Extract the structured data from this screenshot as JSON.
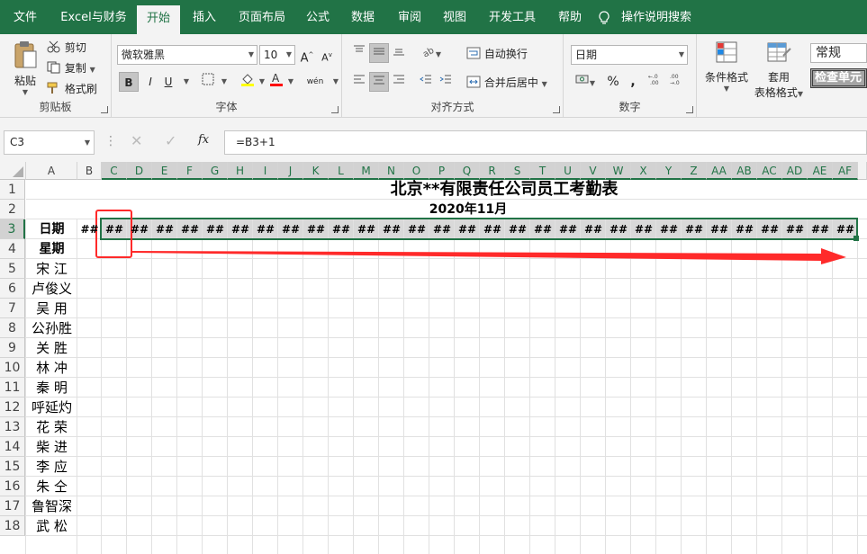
{
  "tabs": [
    {
      "label": "文件"
    },
    {
      "label": "Excel与财务"
    },
    {
      "label": "开始",
      "active": true
    },
    {
      "label": "插入"
    },
    {
      "label": "页面布局"
    },
    {
      "label": "公式"
    },
    {
      "label": "数据"
    },
    {
      "label": "审阅"
    },
    {
      "label": "视图"
    },
    {
      "label": "开发工具"
    },
    {
      "label": "帮助"
    },
    {
      "label": "操作说明搜索"
    }
  ],
  "clipboard": {
    "paste": "粘贴",
    "cut": "剪切",
    "copy": "复制",
    "format_painter": "格式刷",
    "group": "剪贴板"
  },
  "font": {
    "name": "微软雅黑",
    "size": "10",
    "bold": "B",
    "italic": "I",
    "underline": "U",
    "phonetic": "wén",
    "group": "字体"
  },
  "alignment": {
    "wrap": "自动换行",
    "merge": "合并后居中",
    "group": "对齐方式"
  },
  "number": {
    "format": "日期",
    "percent": "%",
    "comma": ",",
    "group": "数字"
  },
  "styles": {
    "conditional": "条件格式",
    "table_line1": "套用",
    "table_line2": "表格格式",
    "normal": "常规",
    "check_cell": "检查单元"
  },
  "formula_bar": {
    "name_box": "C3",
    "formula": "=B3+1",
    "fx": "fx"
  },
  "columns": [
    "A",
    "B",
    "C",
    "D",
    "E",
    "F",
    "G",
    "H",
    "I",
    "J",
    "K",
    "L",
    "M",
    "N",
    "O",
    "P",
    "Q",
    "R",
    "S",
    "T",
    "U",
    "V",
    "W",
    "X",
    "Y",
    "Z",
    "AA",
    "AB",
    "AC",
    "AD",
    "AE",
    "AF"
  ],
  "rows": [
    "1",
    "2",
    "3",
    "4",
    "5",
    "6",
    "7",
    "8",
    "9",
    "10",
    "11",
    "12",
    "13",
    "14",
    "15",
    "16",
    "17",
    "18"
  ],
  "sheet": {
    "title": "北京**有限责任公司员工考勤表",
    "month": "2020年11月",
    "date_label": "日期",
    "weekday_label": "星期",
    "overflow": "##",
    "employees": [
      "宋 江",
      "卢俊义",
      "吴 用",
      "公孙胜",
      "关 胜",
      "林 冲",
      "秦 明",
      "呼延灼",
      "花 荣",
      "柴 进",
      "李 应",
      "朱 仝",
      "鲁智深",
      "武 松"
    ]
  },
  "colors": {
    "accent": "#217346",
    "annotation": "#ff2a2a"
  }
}
